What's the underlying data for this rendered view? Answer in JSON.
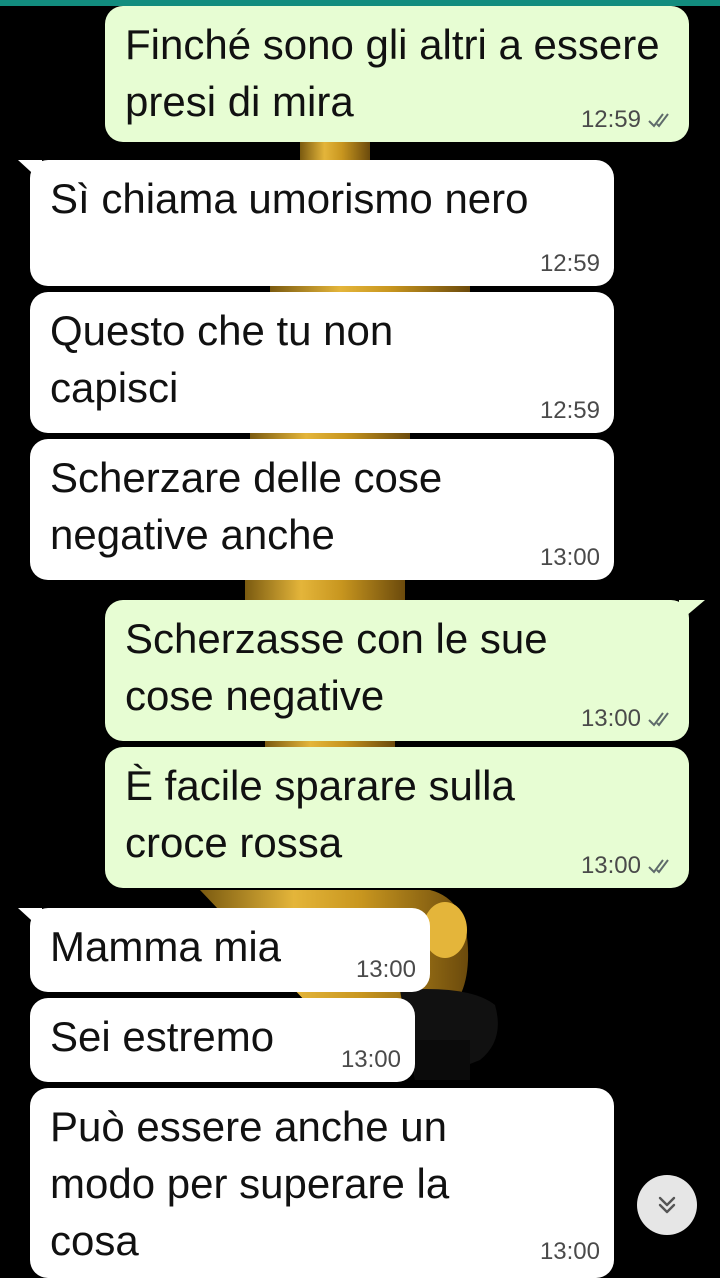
{
  "messages": [
    {
      "direction": "out",
      "text": "Finché sono gli altri a essere presi di mira",
      "time": "12:59",
      "status": "read-ticks-icon"
    },
    {
      "direction": "in",
      "text": "Sì chiama umorismo nero",
      "time": "12:59"
    },
    {
      "direction": "in",
      "text": "Questo che tu non capisci",
      "time": "12:59"
    },
    {
      "direction": "in",
      "text": "Scherzare delle cose negative anche",
      "time": "13:00"
    },
    {
      "direction": "out",
      "text": "Scherzasse con le sue cose negative",
      "time": "13:00",
      "status": "read-ticks-icon"
    },
    {
      "direction": "out",
      "text": "È facile sparare sulla croce rossa",
      "time": "13:00",
      "status": "read-ticks-icon"
    },
    {
      "direction": "in",
      "text": "Mamma mia",
      "time": "13:00"
    },
    {
      "direction": "in",
      "text": "Sei estremo",
      "time": "13:00"
    },
    {
      "direction": "in",
      "text": "Può essere anche un modo per superare la cosa",
      "time": "13:00"
    }
  ],
  "colors": {
    "incoming": "#ffffff",
    "outgoing": "#e7fdd3",
    "accent": "#128c7e",
    "background": "#000000"
  },
  "scroll_button": {
    "icon": "double-chevron-down-icon"
  }
}
